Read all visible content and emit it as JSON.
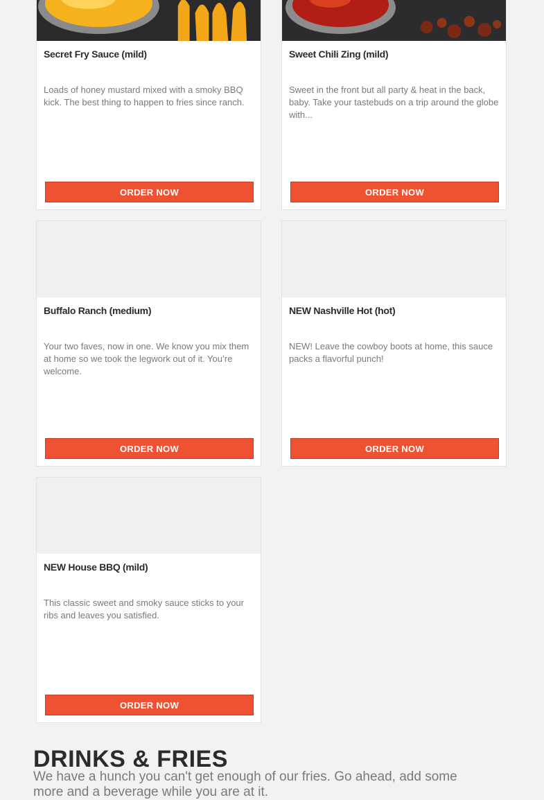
{
  "cards": [
    {
      "title": "Secret Fry Sauce (mild)",
      "description": "Loads of honey mustard mixed with a smoky BBQ kick. The best thing to happen to fries since ranch.",
      "button": "ORDER NOW",
      "image": "secret-fry-sauce-photo"
    },
    {
      "title": "Sweet Chili Zing (mild)",
      "description": "Sweet in the front but all party & heat in the back, baby. Take your tastebuds on a trip around the globe with...",
      "button": "ORDER NOW",
      "image": "sweet-chili-zing-photo"
    },
    {
      "title": "Buffalo Ranch (medium)",
      "description": "Your two faves, now in one. We know you mix them at home so we took the legwork out of it. You’re welcome.",
      "button": "ORDER NOW",
      "image": "placeholder"
    },
    {
      "title": "NEW Nashville Hot (hot)",
      "description": "NEW! Leave the cowboy boots at home, this sauce packs a flavorful punch!",
      "button": "ORDER NOW",
      "image": "placeholder"
    },
    {
      "title": "NEW House BBQ (mild)",
      "description": "This classic sweet and smoky sauce sticks to your ribs and leaves you satisfied.",
      "button": "ORDER NOW",
      "image": "placeholder"
    }
  ],
  "section": {
    "title": "DRINKS & FRIES",
    "subtitle": "We have a hunch you can't get enough of our fries. Go ahead, add some more and a beverage while you are at it."
  },
  "colors": {
    "accent": "#ef5233",
    "card_bg": "#ffffff",
    "page_bg": "#f2f2f2",
    "title_text": "#2b2b2b",
    "body_text": "#7a7a7a"
  }
}
